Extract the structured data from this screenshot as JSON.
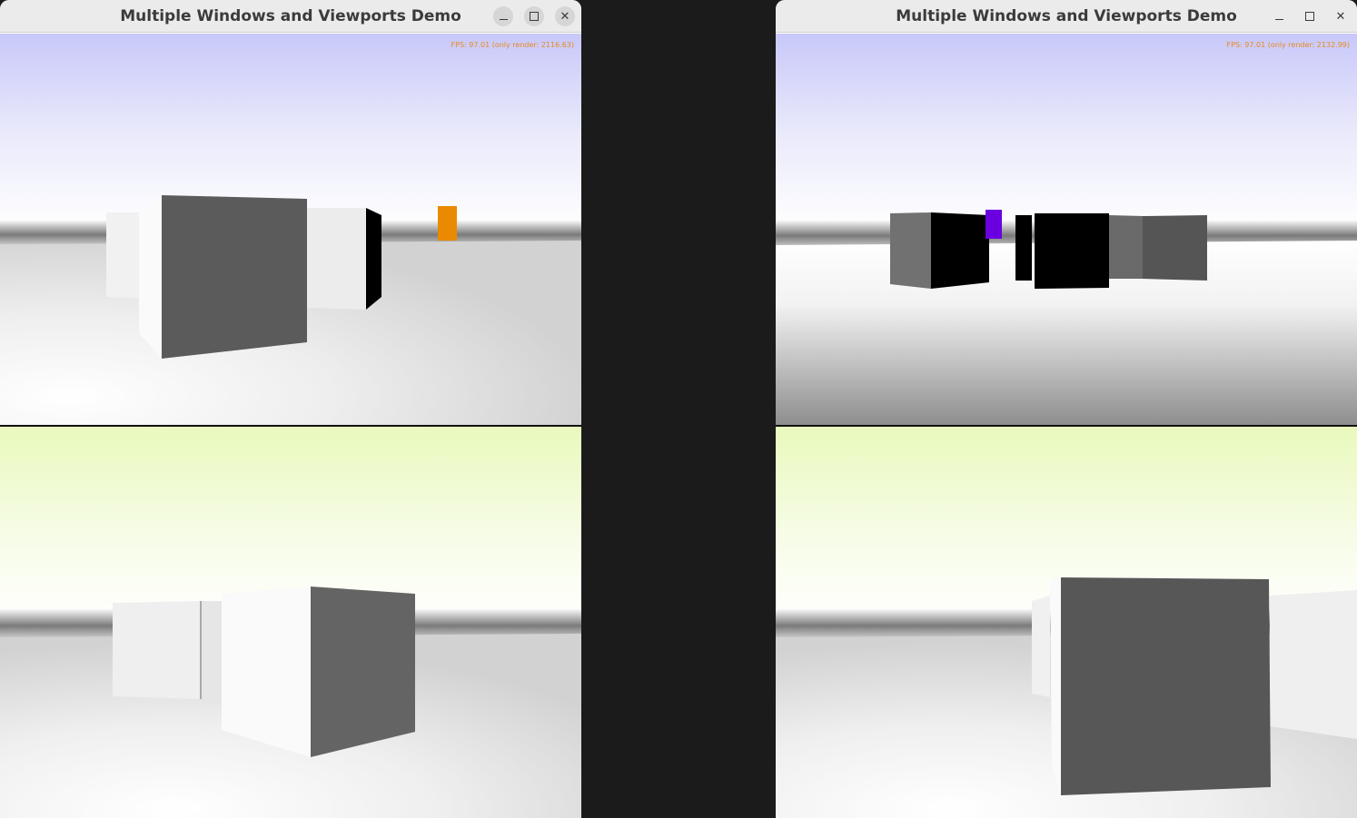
{
  "windows": [
    {
      "title": "Multiple Windows and Viewports Demo",
      "fps_text": "FPS: 97.01 (only render: 2116.63)"
    },
    {
      "title": "Multiple Windows and Viewports Demo",
      "fps_text": "FPS: 97.01 (only render: 2132.99)"
    }
  ],
  "icons": {
    "minimize": "minimize-icon",
    "maximize": "maximize-icon",
    "close": "close-icon"
  },
  "colors": {
    "sky_blue_top": "#c8c8fa",
    "sky_yellow_top": "#e9f9bd",
    "fps_text": "#e58a1f",
    "orange_box": "#ea8a00",
    "purple_box": "#6a00e0",
    "desktop_bg": "#1b1b1b"
  }
}
